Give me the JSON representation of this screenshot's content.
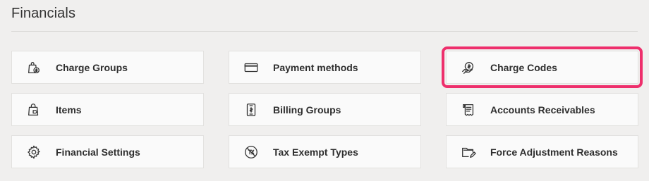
{
  "page": {
    "title": "Financials"
  },
  "cards": [
    {
      "label": "Charge Groups",
      "icon": "shopping-bag-dollar-icon"
    },
    {
      "label": "Payment methods",
      "icon": "credit-card-icon"
    },
    {
      "label": "Charge Codes",
      "icon": "hand-dollar-icon",
      "highlighted": true
    },
    {
      "label": "Items",
      "icon": "shopping-bag-tag-icon"
    },
    {
      "label": "Billing Groups",
      "icon": "receipt-dollar-icon"
    },
    {
      "label": "Accounts Receivables",
      "icon": "invoice-scroll-icon"
    },
    {
      "label": "Financial Settings",
      "icon": "gear-icon"
    },
    {
      "label": "Tax Exempt Types",
      "icon": "no-tax-icon"
    },
    {
      "label": "Force Adjustment Reasons",
      "icon": "folder-edit-icon"
    }
  ],
  "colors": {
    "highlight": "#ee2f6c",
    "background": "#f0efee",
    "card": "#fafafa"
  }
}
